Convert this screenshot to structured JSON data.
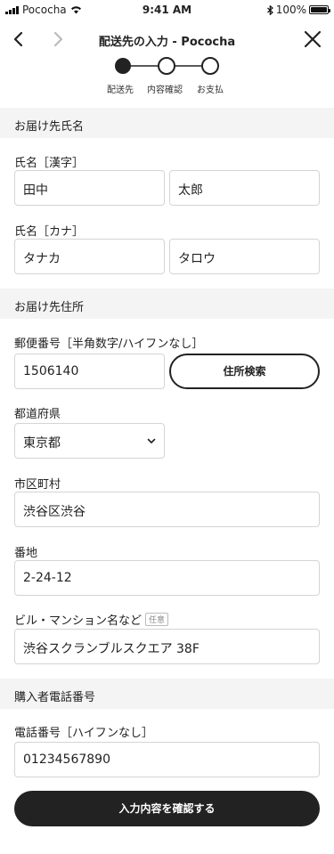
{
  "status_bar": {
    "carrier": "Pococha",
    "time": "9:41 AM",
    "battery": "100%"
  },
  "nav": {
    "title": "配送先の入力 - Pococha"
  },
  "stepper": {
    "current_step": 1,
    "steps": [
      "配送先",
      "内容確認",
      "お支払"
    ]
  },
  "sections": {
    "recipient_name": "お届け先氏名",
    "address": "お届け先住所",
    "phone": "購入者電話番号"
  },
  "form": {
    "name_kanji_label": "氏名［漢字］",
    "last_name_kanji": "田中",
    "first_name_kanji": "太郎",
    "name_kana_label": "氏名［カナ］",
    "last_name_kana": "タナカ",
    "first_name_kana": "タロウ",
    "postal_code_label": "郵便番号［半角数字/ハイフンなし］",
    "postal_code": "1506140",
    "address_search_button": "住所検索",
    "prefecture_label": "都道府県",
    "prefecture": "東京都",
    "city_label": "市区町村",
    "city": "渋谷区渋谷",
    "street_label": "番地",
    "street": "2-24-12",
    "building_label": "ビル・マンション名など",
    "optional_badge": "任意",
    "building": "渋谷スクランブルスクエア 38F",
    "phone_label": "電話番号［ハイフンなし］",
    "phone": "01234567890"
  },
  "submit_button": "入力内容を確認する"
}
